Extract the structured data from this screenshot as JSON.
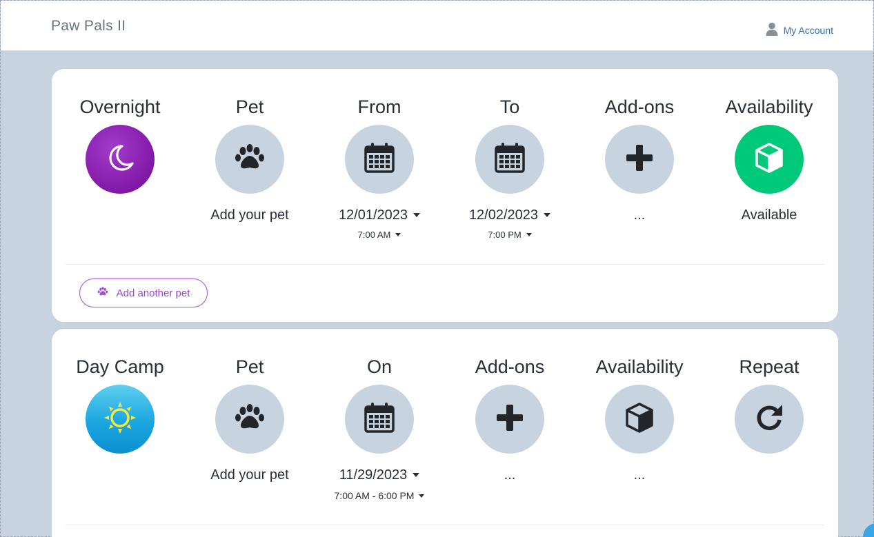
{
  "header": {
    "brand": "Paw Pals II",
    "account_label": "My Account"
  },
  "overnight_card": {
    "columns": [
      {
        "title": "Overnight",
        "icon": "moon-icon"
      },
      {
        "title": "Pet",
        "icon": "paw-icon",
        "value": "Add your pet"
      },
      {
        "title": "From",
        "icon": "calendar-icon",
        "date": "12/01/2023",
        "time": "7:00 AM"
      },
      {
        "title": "To",
        "icon": "calendar-icon",
        "date": "12/02/2023",
        "time": "7:00 PM"
      },
      {
        "title": "Add-ons",
        "icon": "plus-icon",
        "value": "..."
      },
      {
        "title": "Availability",
        "icon": "cube-icon",
        "value": "Available"
      }
    ],
    "add_pet_label": "Add another pet"
  },
  "daycamp_card": {
    "columns": [
      {
        "title": "Day Camp",
        "icon": "sun-icon"
      },
      {
        "title": "Pet",
        "icon": "paw-icon",
        "value": "Add your pet"
      },
      {
        "title": "On",
        "icon": "calendar-icon",
        "date": "11/29/2023",
        "time": "7:00 AM - 6:00 PM"
      },
      {
        "title": "Add-ons",
        "icon": "plus-icon",
        "value": "..."
      },
      {
        "title": "Availability",
        "icon": "cube-icon",
        "value": "..."
      },
      {
        "title": "Repeat",
        "icon": "repeat-icon"
      }
    ]
  },
  "colors": {
    "page_bg": "#c8d3e0",
    "icon_circle": "#c8d3e0",
    "overnight_purple": "#8a1fb0",
    "daycamp_blue": "#1aa6e0",
    "available_green": "#00c97a",
    "link_blue": "#2f6fae",
    "accent_purple": "#9b46cf"
  }
}
